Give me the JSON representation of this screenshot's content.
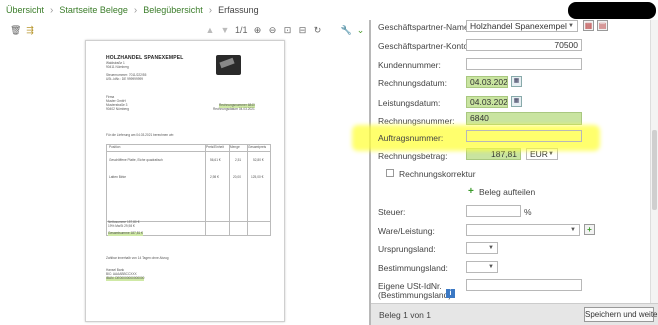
{
  "breadcrumb": {
    "items": [
      "Übersicht",
      "Startseite Belege",
      "Belegübersicht",
      "Erfassung"
    ]
  },
  "viewer_toolbar": {
    "page_indicator": "1/1"
  },
  "document": {
    "company_logo": "HOLZHANDEL SPANEXEMPEL",
    "sender_lines": [
      "Waldstraße 1",
      "90411 Nürnberg"
    ],
    "tax_lines": [
      "Steuernummer: 7011/222/55",
      "USt.-IdNr.: DE 999999999"
    ],
    "recipient_lines": [
      "Firma",
      "Muster GmbH",
      "Musterstraße 3",
      "90402 Nürnberg"
    ],
    "invoice_number_line": "Rechnungsnummer 6840",
    "invoice_date_line": "Rechnungsdatum 04.03.2021",
    "delivery_line": "Für die Lieferung am 04.03.2021 berechnen wir:",
    "table_headers": [
      "Position",
      "Preis/Einheit",
      "Menge",
      "Gesamtpreis"
    ],
    "rows": [
      {
        "desc": "Geschliffene Platte, Eiche quadratisch",
        "price": "56,61 €",
        "qty": "2,51",
        "total": "52,80 €"
      },
      {
        "desc": "Latten Birke",
        "price": "2,98 €",
        "qty": "20,00",
        "total": "125,00 €"
      }
    ],
    "totals": [
      "Nettosumme 157,80 €",
      "19% MwSt 29,98 €",
      "Gesamtsumme 187,81 €"
    ],
    "payment_line": "Zahlbar innerhalb von 14 Tagen ohne Abzug",
    "bank_lines": [
      "Hansel Bank",
      "BIC: AAAABBCCXXX",
      "IBAN: DE00000000000000"
    ]
  },
  "form": {
    "partner_name_label": "Geschäftspartner-Name:",
    "partner_name_value": "Holzhandel Spanexempel",
    "partner_account_label": "Geschäftspartner-Konto:",
    "partner_account_value": "70500",
    "customer_number_label": "Kundennummer:",
    "customer_number_value": "",
    "invoice_date_label": "Rechnungsdatum:",
    "invoice_date_value": "04.03.2021",
    "delivery_date_label": "Leistungsdatum:",
    "delivery_date_value": "04.03.2021",
    "invoice_number_label": "Rechnungsnummer:",
    "invoice_number_value": "6840",
    "order_number_label": "Auftragsnummer:",
    "order_number_value": "",
    "invoice_amount_label": "Rechnungsbetrag:",
    "invoice_amount_value": "187,81",
    "currency_value": "EUR",
    "correction_label": "Rechnungskorrektur",
    "split_label": "Beleg aufteilen",
    "tax_label": "Steuer:",
    "tax_unit": "%",
    "goods_label": "Ware/Leistung:",
    "origin_label": "Ursprungsland:",
    "destination_label": "Bestimmungsland:",
    "vat_label_line1": "Eigene USt-IdNr.",
    "vat_label_line2": "(Bestimmungsland):"
  },
  "footer": {
    "status": "Beleg 1 von 1",
    "save_next_button": "Speichern und weiter"
  },
  "colors": {
    "accent_green": "#4a9a2a",
    "field_green": "#c9e4a0",
    "highlight_yellow": "#ffff3c"
  }
}
